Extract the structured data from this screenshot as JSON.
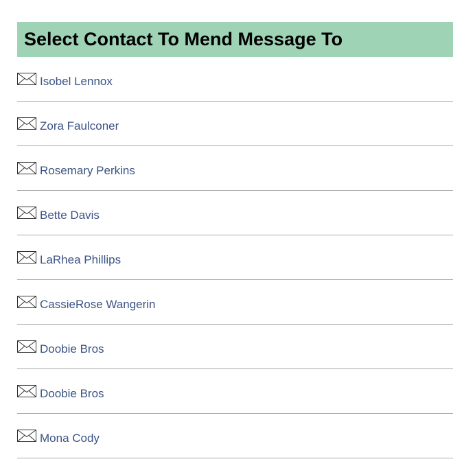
{
  "header": {
    "title": "Select Contact To Mend Message To"
  },
  "contacts": [
    {
      "name": "Isobel Lennox",
      "icon": "envelope-icon"
    },
    {
      "name": "Zora Faulconer",
      "icon": "envelope-icon"
    },
    {
      "name": "Rosemary Perkins",
      "icon": "envelope-icon"
    },
    {
      "name": "Bette Davis",
      "icon": "envelope-icon"
    },
    {
      "name": "LaRhea Phillips",
      "icon": "envelope-icon"
    },
    {
      "name": "CassieRose Wangerin",
      "icon": "envelope-icon"
    },
    {
      "name": "Doobie Bros",
      "icon": "envelope-icon"
    },
    {
      "name": "Doobie Bros",
      "icon": "envelope-icon"
    },
    {
      "name": "Mona Cody",
      "icon": "envelope-icon"
    }
  ],
  "colors": {
    "header_bg": "#9ed3b6",
    "link_text": "#3b5384",
    "divider": "#a8a8a8"
  }
}
